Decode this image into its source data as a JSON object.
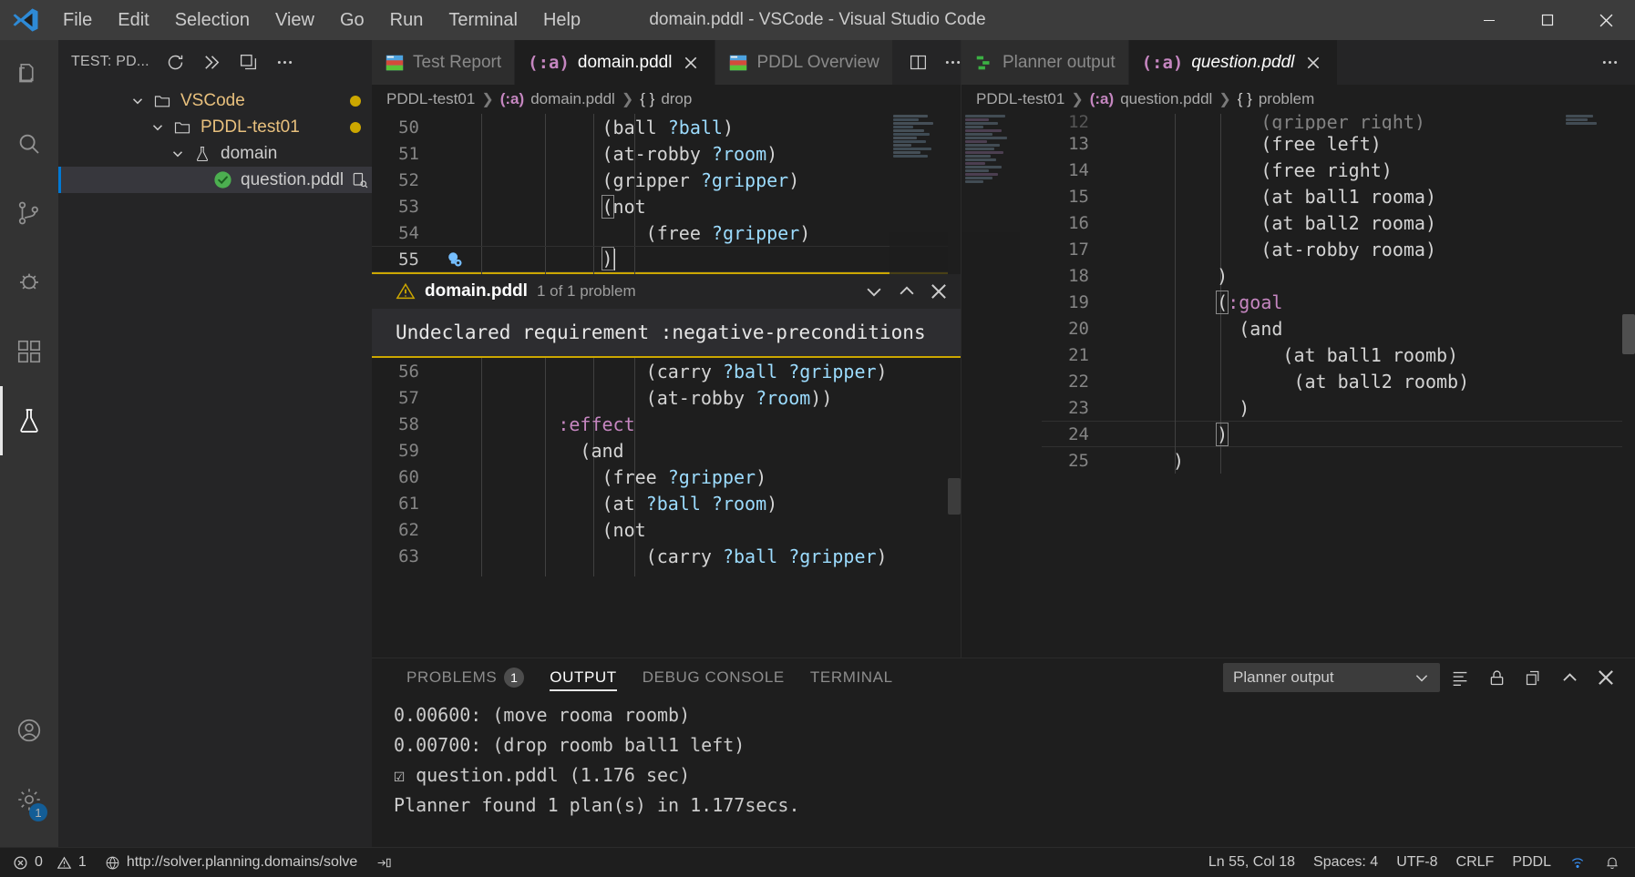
{
  "window": {
    "title": "domain.pddl - VSCode - Visual Studio Code",
    "menu": [
      "File",
      "Edit",
      "Selection",
      "View",
      "Go",
      "Run",
      "Terminal",
      "Help"
    ],
    "controls": {
      "minimize": "minimize-button",
      "maximize": "maximize-button",
      "close": "close-button"
    }
  },
  "activitybar": {
    "items": [
      {
        "name": "explorer",
        "icon": "files-icon"
      },
      {
        "name": "search",
        "icon": "search-icon"
      },
      {
        "name": "source-control",
        "icon": "source-control-icon"
      },
      {
        "name": "run-and-debug",
        "icon": "debug-icon"
      },
      {
        "name": "extensions",
        "icon": "extensions-icon"
      },
      {
        "name": "testing",
        "icon": "beaker-icon",
        "active": true
      }
    ],
    "bottom": [
      {
        "name": "accounts",
        "icon": "account-icon"
      },
      {
        "name": "manage",
        "icon": "gear-icon",
        "badge": "1"
      }
    ]
  },
  "sidebar": {
    "title": "TEST: PD...",
    "actions": [
      "refresh-icon",
      "run-all-tests-icon",
      "collapse-all-icon",
      "more-actions-icon"
    ],
    "tree": [
      {
        "label": "VSCode",
        "type": "folder",
        "indent": 0,
        "expanded": true,
        "dirty": true
      },
      {
        "label": "PDDL-test01",
        "type": "folder",
        "indent": 1,
        "expanded": true,
        "dirty": true
      },
      {
        "label": "domain",
        "type": "beaker",
        "indent": 2,
        "expanded": true,
        "dirty": false
      },
      {
        "label": "question.pddl",
        "type": "test-passed",
        "indent": 3,
        "expanded": false,
        "selected": true,
        "dirty": false
      }
    ]
  },
  "left_editor": {
    "tabs": [
      {
        "label": "Test Report",
        "icon": "pddl-preview-icon",
        "active": false,
        "closable": false
      },
      {
        "label": "domain.pddl",
        "icon": "pddl-icon",
        "active": true,
        "closable": true
      },
      {
        "label": "PDDL Overview",
        "icon": "pddl-preview-icon",
        "active": false,
        "closable": false
      }
    ],
    "actions": [
      "split-editor-icon",
      "more-actions-icon"
    ],
    "breadcrumb": [
      "PDDL-test01",
      "domain.pddl",
      "drop"
    ],
    "lines_top": [
      {
        "n": "50",
        "indent": 12,
        "text": "(ball ?ball)"
      },
      {
        "n": "51",
        "indent": 12,
        "text": "(at-robby ?room)"
      },
      {
        "n": "52",
        "indent": 12,
        "text": "(gripper ?gripper)"
      },
      {
        "n": "53",
        "indent": 12,
        "text": "(not"
      },
      {
        "n": "54",
        "indent": 16,
        "text": "(free ?gripper)"
      },
      {
        "n": "55",
        "indent": 12,
        "text": ")"
      }
    ],
    "lines_bottom": [
      {
        "n": "56",
        "indent": 16,
        "text": "(carry ?ball ?gripper)"
      },
      {
        "n": "57",
        "indent": 16,
        "text": "(at-robby ?room))"
      },
      {
        "n": "58",
        "indent": 8,
        "text": ":effect"
      },
      {
        "n": "59",
        "indent": 10,
        "text": "(and"
      },
      {
        "n": "60",
        "indent": 12,
        "text": "(free ?gripper)"
      },
      {
        "n": "61",
        "indent": 12,
        "text": "(at ?ball ?room)"
      },
      {
        "n": "62",
        "indent": 12,
        "text": "(not"
      },
      {
        "n": "63",
        "indent": 16,
        "text": "(carry ?ball ?gripper)"
      }
    ],
    "peek": {
      "icon": "warning-icon",
      "file": "domain.pddl",
      "count": "1 of 1 problem",
      "message": "Undeclared requirement :negative-preconditions",
      "actions": [
        "chevron-down-icon",
        "chevron-up-icon",
        "close-icon"
      ]
    },
    "lightbulb": "lightbulb-code-action-icon"
  },
  "right_editor": {
    "tabs": [
      {
        "label": "Planner output",
        "icon": "planner-output-icon",
        "active": false,
        "closable": false
      },
      {
        "label": "question.pddl",
        "icon": "pddl-icon",
        "active": true,
        "closable": true,
        "italic": true
      }
    ],
    "actions": [
      "more-actions-icon"
    ],
    "breadcrumb": [
      "PDDL-test01",
      "question.pddl",
      "problem"
    ],
    "lines": [
      {
        "n": "12",
        "indent": 8,
        "text": "(gripper right)",
        "clipped": true
      },
      {
        "n": "13",
        "indent": 8,
        "text": "(free left)"
      },
      {
        "n": "14",
        "indent": 8,
        "text": "(free right)"
      },
      {
        "n": "15",
        "indent": 8,
        "text": "(at ball1 rooma)"
      },
      {
        "n": "16",
        "indent": 8,
        "text": "(at ball2 rooma)"
      },
      {
        "n": "17",
        "indent": 8,
        "text": "(at-robby rooma)"
      },
      {
        "n": "18",
        "indent": 4,
        "text": ")"
      },
      {
        "n": "19",
        "indent": 4,
        "text": "(:goal"
      },
      {
        "n": "20",
        "indent": 6,
        "text": "(and"
      },
      {
        "n": "21",
        "indent": 10,
        "text": "(at ball1 roomb)"
      },
      {
        "n": "22",
        "indent": 11,
        "text": "(at ball2 roomb)"
      },
      {
        "n": "23",
        "indent": 6,
        "text": ")"
      },
      {
        "n": "24",
        "indent": 4,
        "text": ")"
      },
      {
        "n": "25",
        "indent": 0,
        "text": ")"
      }
    ]
  },
  "panel": {
    "tabs": [
      {
        "label": "PROBLEMS",
        "badge": "1",
        "active": false
      },
      {
        "label": "OUTPUT",
        "badge": "",
        "active": true
      },
      {
        "label": "DEBUG CONSOLE",
        "badge": "",
        "active": false
      },
      {
        "label": "TERMINAL",
        "badge": "",
        "active": false
      }
    ],
    "channel": "Planner output",
    "actions": [
      "clear-output-icon",
      "lock-scroll-icon",
      "open-in-editor-icon",
      "maximize-panel-icon",
      "close-panel-icon"
    ],
    "output": [
      "0.00600: (move rooma roomb)",
      "0.00700: (drop roomb ball1 left)",
      "☑ question.pddl (1.176 sec)",
      "Planner found 1 plan(s) in 1.177secs."
    ]
  },
  "statusbar": {
    "left": [
      {
        "name": "problems",
        "icon": "error-icon",
        "text": "0"
      },
      {
        "name": "warnings",
        "icon": "warning-icon",
        "text": "1"
      },
      {
        "name": "planner-url",
        "icon": "globe-icon",
        "text": "http://solver.planning.domains/solve"
      },
      {
        "name": "ports",
        "icon": "ports-icon",
        "text": ""
      }
    ],
    "right": [
      {
        "name": "cursor-position",
        "text": "Ln 55, Col 18"
      },
      {
        "name": "indentation",
        "text": "Spaces: 4"
      },
      {
        "name": "encoding",
        "text": "UTF-8"
      },
      {
        "name": "eol",
        "text": "CRLF"
      },
      {
        "name": "language-mode",
        "text": "PDDL"
      },
      {
        "name": "remote-indicator",
        "text": ""
      },
      {
        "name": "notifications",
        "text": ""
      }
    ]
  },
  "colors": {
    "accent": "#0078d4",
    "warning": "#cca700",
    "folder_label": "#e8c07d",
    "keyword": "#c586c0",
    "variable": "#9cdcfe",
    "pass_green": "#4caf50"
  }
}
